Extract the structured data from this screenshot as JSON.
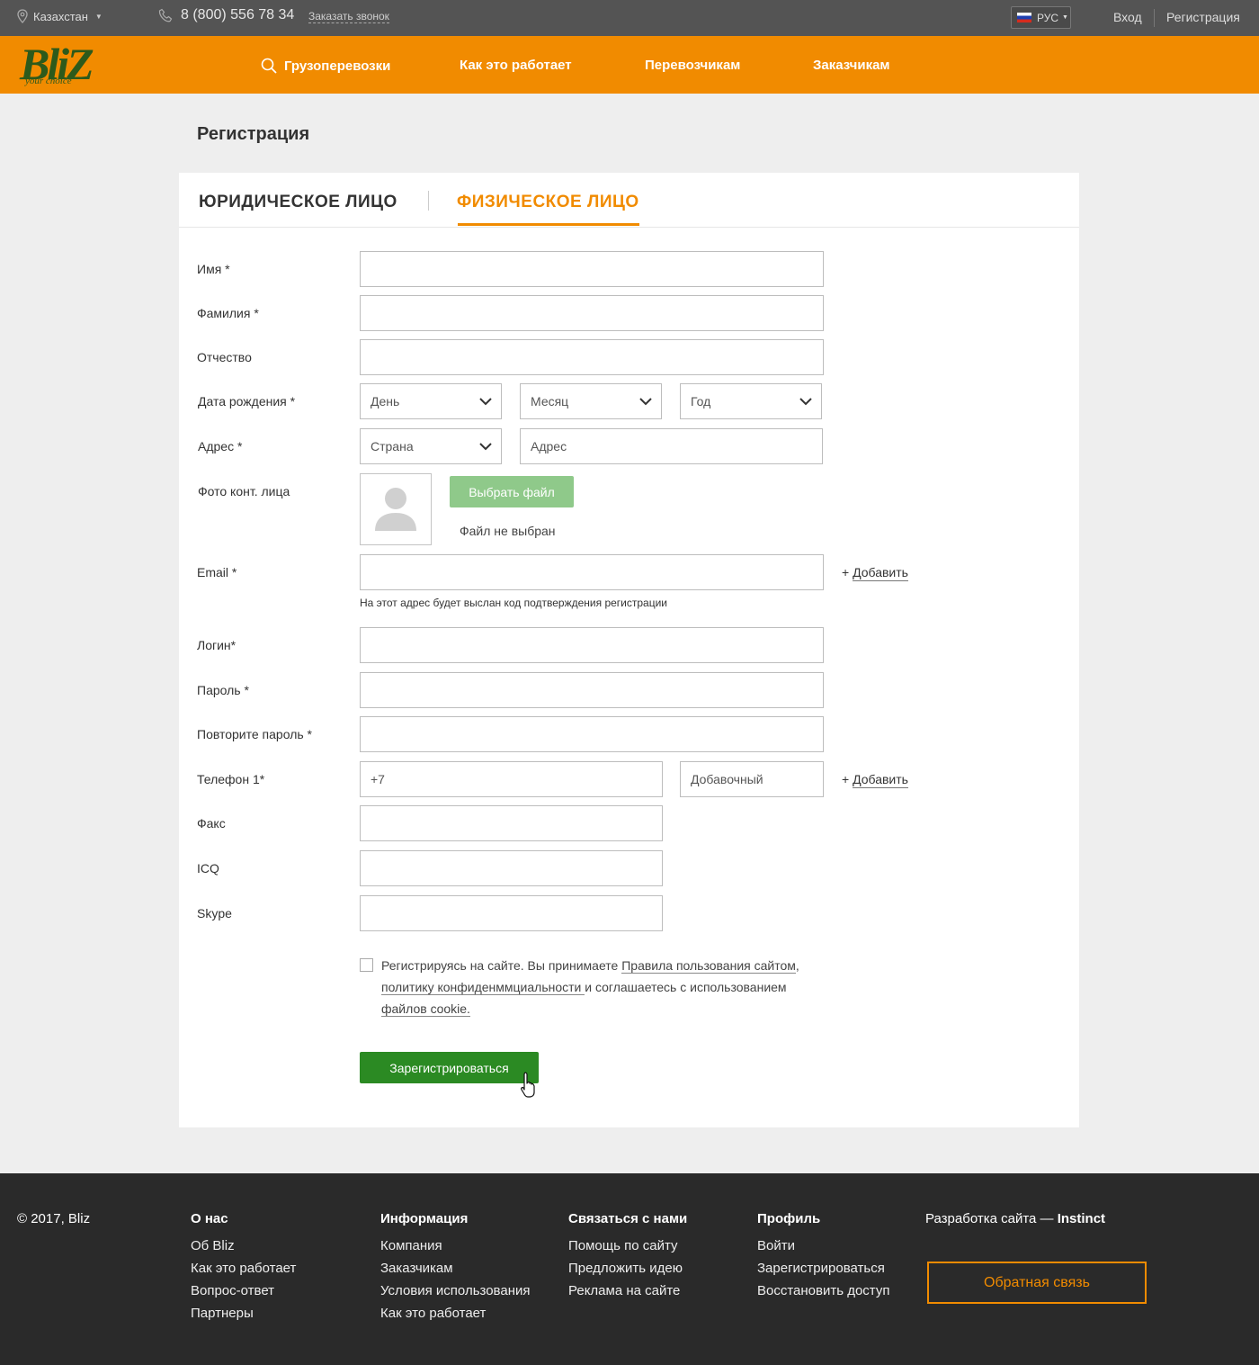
{
  "topbar": {
    "city": "Казахстан",
    "phone": "8 (800) 556 78 34",
    "callback": "Заказать звонок",
    "lang": "РУС",
    "login": "Вход",
    "register": "Регистрация"
  },
  "header": {
    "logo_text": "BliZ",
    "logo_tagline": "your choice",
    "nav": [
      "Грузоперевозки",
      "Как это работает",
      "Перевозчикам",
      "Заказчикам"
    ]
  },
  "page": {
    "title": "Регистрация"
  },
  "tabs": {
    "legal": "ЮРИДИЧЕСКОЕ ЛИЦО",
    "individual": "ФИЗИЧЕСКОЕ ЛИЦО"
  },
  "form": {
    "labels": {
      "first_name": "Имя *",
      "last_name": "Фамилия *",
      "patronymic": "Отчество",
      "birth_date": "Дата рождения *",
      "address": "Адрес *",
      "photo": "Фото конт. лица",
      "email": "Email *",
      "login": "Логин*",
      "password": "Пароль *",
      "password_repeat": "Повторите пароль *",
      "phone": "Телефон 1*",
      "fax": "Факс",
      "icq": "ICQ",
      "skype": "Skype"
    },
    "birth": {
      "day": "День",
      "month": "Месяц",
      "year": "Год"
    },
    "address": {
      "country": "Страна",
      "address_placeholder": "Адрес"
    },
    "photo": {
      "button": "Выбрать файл",
      "status": "Файл не выбран"
    },
    "email_hint": "На этот адрес будет выслан код подтверждения регистрации",
    "add_label": "+ ",
    "add_link": "Добавить",
    "phone": {
      "value": "+7",
      "ext_placeholder": "Добавочный"
    },
    "agreement": {
      "text1": "Регистрируясь на сайте. Вы принимаете ",
      "link1": "Правила пользования сайтом",
      "text2": ",",
      "link2": "политику конфиденммциальности ",
      "text3": "и соглашаетесь с использованием",
      "link3": "файлов cookie."
    },
    "submit": "Зарегистрироваться"
  },
  "footer": {
    "copyright": "© 2017, Bliz",
    "columns": [
      {
        "title": "О нас",
        "links": [
          "Об Bliz",
          "Как это работает",
          "Вопрос-ответ",
          "Партнеры"
        ]
      },
      {
        "title": "Информация",
        "links": [
          "Компания",
          "Заказчикам",
          "Условия использования",
          "Как это работает"
        ]
      },
      {
        "title": "Связаться с нами",
        "links": [
          "Помощь по сайту",
          "Предложить идею",
          "Реклама на сайте"
        ]
      },
      {
        "title": "Профиль",
        "links": [
          "Войти",
          "Зарегистрироваться",
          "Восстановить доступ"
        ]
      }
    ],
    "dev_prefix": "Разработка сайта — ",
    "dev_name": "Instinct",
    "feedback": "Обратная связь"
  },
  "colors": {
    "accent": "#f18b00",
    "submit": "#2b8a23",
    "file_button": "#8fc98a",
    "topbar": "#545454",
    "footer": "#2a2a2a"
  }
}
